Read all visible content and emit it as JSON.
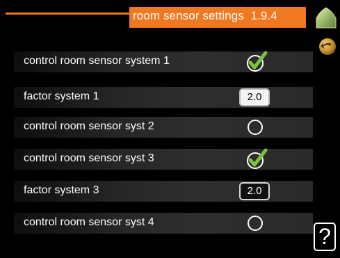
{
  "header": {
    "title": "room sensor settings",
    "menu_number": "1.9.4",
    "accent_color": "#f07820"
  },
  "nav": {
    "home_icon": "home-icon",
    "back_icon": "back-icon",
    "help_label": "?"
  },
  "rows": [
    {
      "label": "control room sensor system 1",
      "control": "checkbox",
      "checked": true
    },
    {
      "label": "factor system 1",
      "control": "number",
      "value": "2.0",
      "selected": true
    },
    {
      "label": "control room sensor syst 2",
      "control": "checkbox",
      "checked": false
    },
    {
      "label": "control room sensor syst 3",
      "control": "checkbox",
      "checked": true
    },
    {
      "label": "factor system 3",
      "control": "number",
      "value": "2.0",
      "selected": false
    },
    {
      "label": "control room sensor syst 4",
      "control": "checkbox",
      "checked": false
    }
  ]
}
